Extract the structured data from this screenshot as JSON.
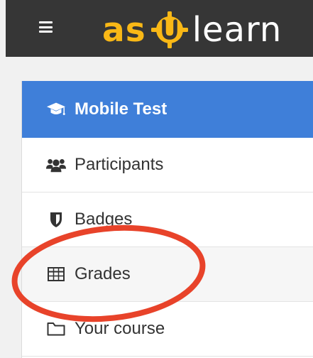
{
  "header": {
    "logo_part1": "as",
    "logo_part2": "learn",
    "menu_icon": "hamburger-menu-icon",
    "logo_icon": "u-logo-icon",
    "brand_color": "#f9b816",
    "bar_color": "#363636"
  },
  "sidebar": {
    "items": [
      {
        "label": "Mobile Test",
        "icon": "graduation-cap-icon",
        "active": true
      },
      {
        "label": "Participants",
        "icon": "users-icon"
      },
      {
        "label": "Badges",
        "icon": "shield-icon"
      },
      {
        "label": "Grades",
        "icon": "table-icon"
      },
      {
        "label": "Your course",
        "icon": "folder-icon"
      }
    ],
    "active_color": "#3f7fd9"
  },
  "annotation": {
    "color": "#e8432a",
    "target": "Grades"
  }
}
